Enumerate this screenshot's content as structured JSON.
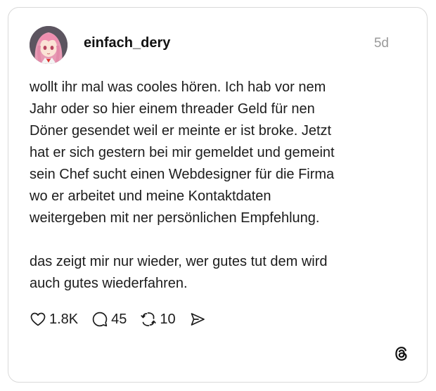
{
  "post": {
    "username": "einfach_dery",
    "timestamp": "5d",
    "paragraph1_lines": [
      "wollt ihr mal was cooles hören. Ich hab vor nem",
      "Jahr oder so hier einem threader Geld für nen",
      "Döner gesendet weil er meinte er ist broke. Jetzt",
      "hat er sich gestern bei mir gemeldet und gemeint",
      "sein Chef sucht einen Webdesigner für die Firma",
      "wo er arbeitet und meine Kontaktdaten",
      "weitergeben mit ner persönlichen Empfehlung."
    ],
    "paragraph2_lines": [
      "das zeigt mir nur wieder, wer gutes tut dem wird",
      "auch gutes wiederfahren."
    ]
  },
  "actions": {
    "likes": "1.8K",
    "replies": "45",
    "reposts": "10"
  },
  "icons": {
    "like": "heart-icon",
    "reply": "speech-bubble-icon",
    "repost": "repost-arrows-icon",
    "share": "send-icon",
    "brand": "threads-logo-icon"
  },
  "colors": {
    "border": "#d9d9d9",
    "timestamp": "#9a9a9a",
    "text": "#1c1c1c"
  }
}
